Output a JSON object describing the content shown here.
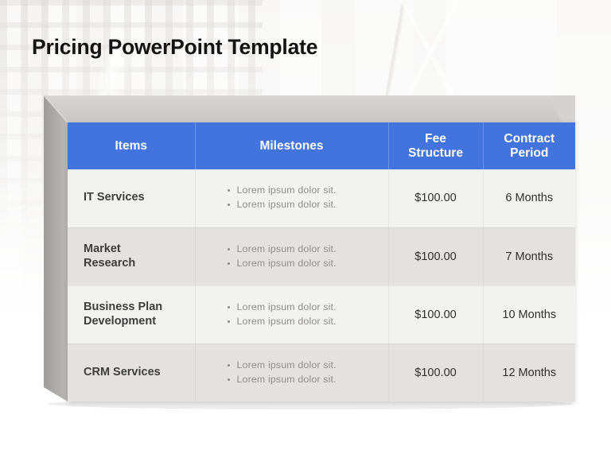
{
  "slide": {
    "title": "Pricing PowerPoint Template"
  },
  "colors": {
    "header_blue": "#4374dd",
    "header_text": "#ffffff",
    "row_light": "#f2f2f1",
    "row_dark": "#e3e2e0",
    "box_top_face": "#d0cfcd",
    "box_left_face": "#a8a7a5",
    "item_text": "#3d3d3d",
    "milestone_text": "#8e8d8c",
    "value_text": "#2f2f2f",
    "title_text": "#141414"
  },
  "table": {
    "headers": [
      {
        "label": "Items"
      },
      {
        "label": "Milestones"
      },
      {
        "label": "Fee\nStructure"
      },
      {
        "label": "Contract\nPeriod"
      }
    ],
    "header_labels": {
      "items": "Items",
      "milestones": "Milestones",
      "fee_line1": "Fee",
      "fee_line2": "Structure",
      "period_line1": "Contract",
      "period_line2": "Period"
    },
    "rows": [
      {
        "item": "IT Services",
        "item_line1": "IT Services",
        "item_line2": "",
        "milestones": [
          "Lorem ipsum dolor sit.",
          "Lorem ipsum dolor sit."
        ],
        "fee": "$100.00",
        "period": "6 Months",
        "shade": "light"
      },
      {
        "item": "Market Research",
        "item_line1": "Market",
        "item_line2": "Research",
        "milestones": [
          "Lorem ipsum dolor sit.",
          "Lorem ipsum dolor sit."
        ],
        "fee": "$100.00",
        "period": "7 Months",
        "shade": "dark"
      },
      {
        "item": "Business Plan Development",
        "item_line1": "Business Plan",
        "item_line2": "Development",
        "milestones": [
          "Lorem ipsum dolor sit.",
          "Lorem ipsum dolor sit."
        ],
        "fee": "$100.00",
        "period": "10 Months",
        "shade": "light"
      },
      {
        "item": "CRM Services",
        "item_line1": "CRM Services",
        "item_line2": "",
        "milestones": [
          "Lorem ipsum dolor sit.",
          "Lorem ipsum dolor sit."
        ],
        "fee": "$100.00",
        "period": "12 Months",
        "shade": "dark"
      }
    ]
  }
}
